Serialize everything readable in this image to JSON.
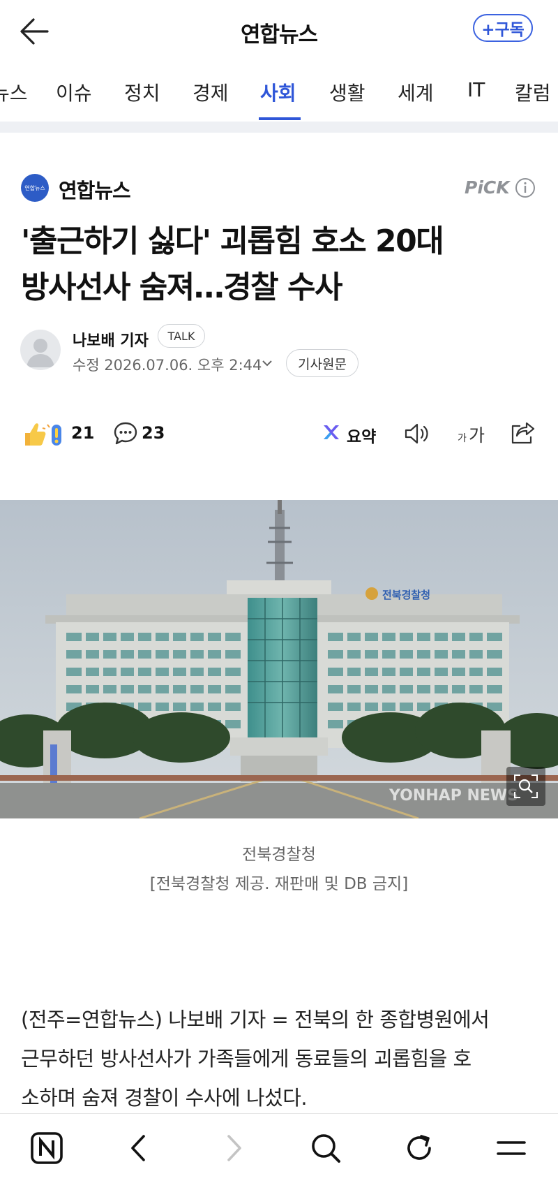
{
  "app": {
    "title": "연합뉴스",
    "subscribe_label": "+구독"
  },
  "tabs": [
    "뉴스",
    "이슈",
    "정치",
    "경제",
    "사회",
    "생활",
    "세계",
    "IT",
    "칼럼"
  ],
  "active_tab": "사회",
  "press": {
    "logo_text": "연합뉴스",
    "name": "연합뉴스",
    "pick_label": "PiCK"
  },
  "article": {
    "headline_line1": "'출근하기 싫다' 괴롭힘 호소 20대",
    "headline_line2": "방사선사 숨져…경찰 수사",
    "reporter": "나보배 기자",
    "talk_label": "TALK",
    "date": "수정 2026.07.06. 오후 2:44",
    "source_label": "기사원문",
    "reaction_count": "21",
    "comment_count": "23",
    "summary_label": "요약",
    "photo_caption": "전북경찰청",
    "photo_credit": "[전북경찰청 제공. 재판매 및 DB 금지]",
    "photo_sign": "전북경찰청",
    "photo_watermark": "YONHAP NEWS",
    "body_line1": "(전주=연합뉴스) 나보배 기자 = 전북의 한 종합병원에서",
    "body_line2": "근무하던 방사선사가 가족들에게 동료들의 괴롭힘을 호",
    "body_line3": "소하며 숨져 경찰이 수사에 나섰다."
  },
  "colors": {
    "accent": "#2f56d8",
    "press_logo": "#2d5cc6"
  },
  "icons": {
    "top": [
      "back-arrow-icon"
    ],
    "reactions": [
      "reaction-emoji-icon",
      "comment-icon"
    ],
    "tools": [
      "summary-icon",
      "speaker-icon",
      "font-size-icon",
      "share-icon"
    ],
    "bottom_nav": [
      "naver-home-icon",
      "back-chevron-icon",
      "forward-chevron-icon",
      "search-icon",
      "refresh-icon",
      "menu-icon"
    ]
  }
}
